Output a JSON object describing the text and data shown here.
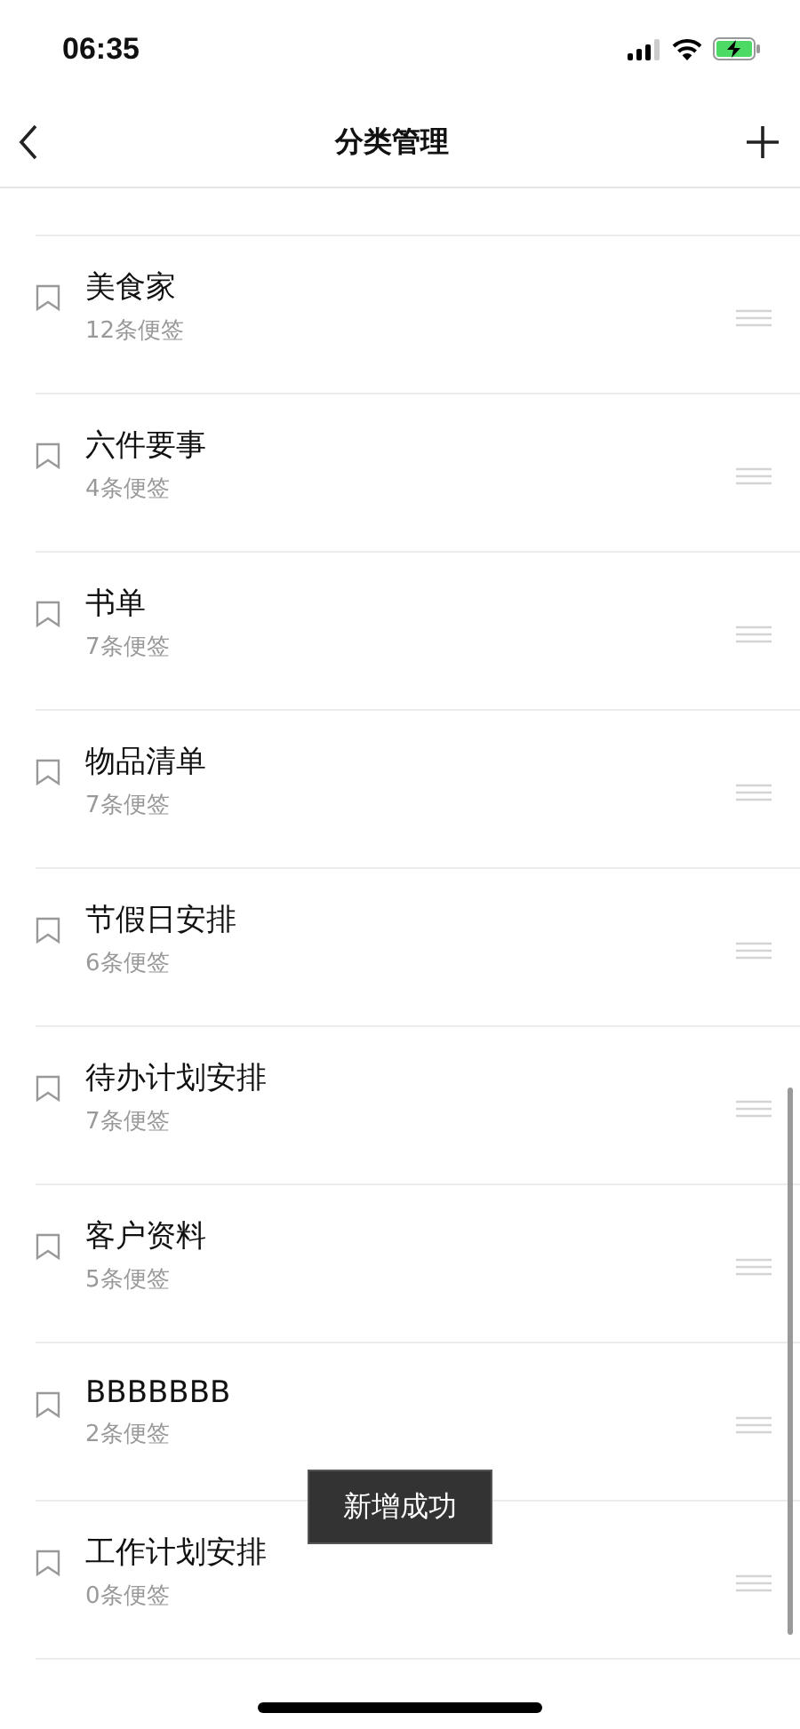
{
  "status_bar": {
    "time": "06:35"
  },
  "nav_bar": {
    "title": "分类管理"
  },
  "categories": [
    {
      "name": "美食家",
      "count": "12条便签"
    },
    {
      "name": "六件要事",
      "count": "4条便签"
    },
    {
      "name": "书单",
      "count": "7条便签"
    },
    {
      "name": "物品清单",
      "count": "7条便签"
    },
    {
      "name": "节假日安排",
      "count": "6条便签"
    },
    {
      "name": "待办计划安排",
      "count": "7条便签"
    },
    {
      "name": "客户资料",
      "count": "5条便签"
    },
    {
      "name": "BBBBBBB",
      "count": "2条便签"
    },
    {
      "name": "工作计划安排",
      "count": "0条便签"
    }
  ],
  "toast": {
    "text": "新增成功"
  }
}
